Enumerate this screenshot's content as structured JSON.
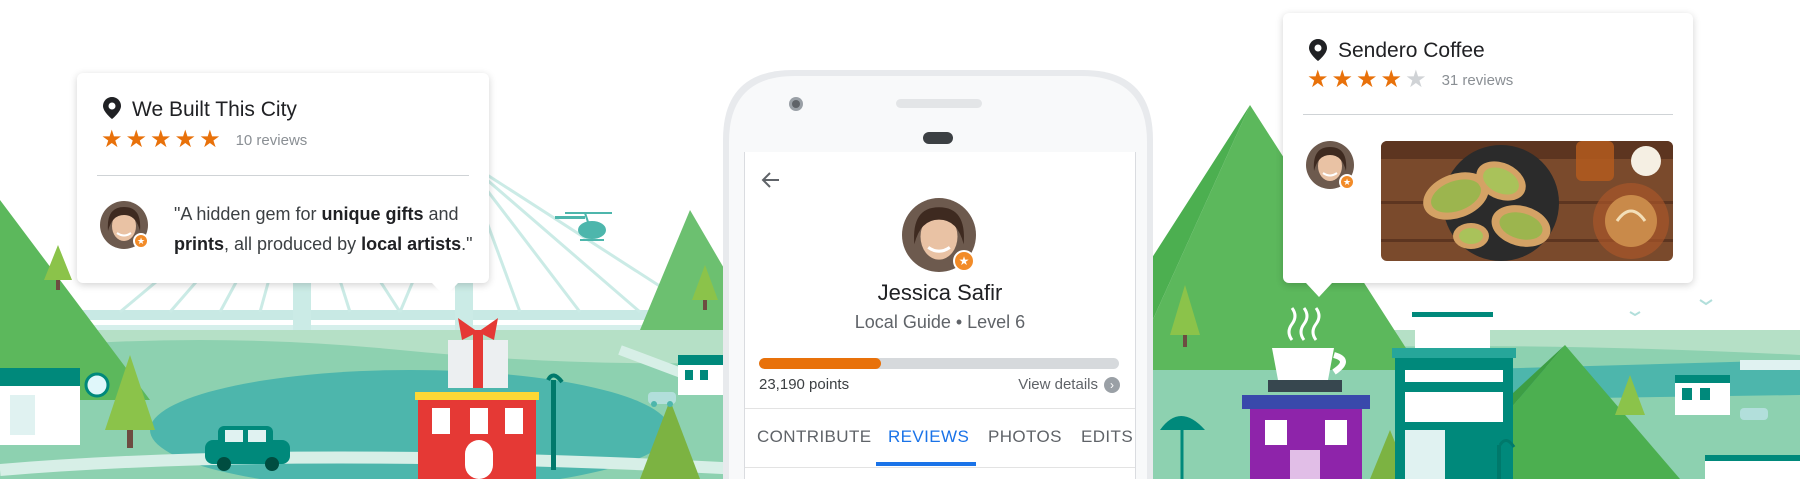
{
  "colors": {
    "star_filled": "#e8710a",
    "star_empty": "#d0d3d6",
    "progress_fill": "#e8710a",
    "progress_track": "#d6d9dc",
    "tab_active": "#1a73e8",
    "badge": "#f28b28"
  },
  "left_card": {
    "icon": "map-pin-icon",
    "title": "We Built This City",
    "rating": 5,
    "reviews": "10 reviews",
    "quote_parts": {
      "p1": "\"A hidden gem for ",
      "b1": "unique gifts",
      "p2": " and",
      "b2": "prints",
      "p3": ", all produced by ",
      "b3": "local artists",
      "p4": ".\""
    }
  },
  "right_card": {
    "icon": "map-pin-icon",
    "title": "Sendero Coffee",
    "rating": 4,
    "reviews": "31 reviews",
    "photo": "avocado-toast-photo"
  },
  "phone": {
    "back_icon": "arrow-back-icon",
    "name": "Jessica Safir",
    "subtitle": "Local Guide • Level 6",
    "points": "23,190 points",
    "progress": 0.34,
    "view_details": "View details",
    "tabs": [
      "CONTRIBUTE",
      "REVIEWS",
      "PHOTOS",
      "EDITS"
    ],
    "active_tab": 1
  }
}
